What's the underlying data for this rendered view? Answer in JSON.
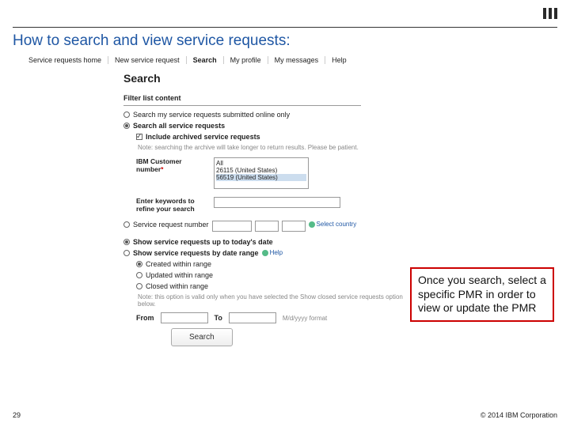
{
  "header": {
    "title": "How to search and view service requests:"
  },
  "nav": {
    "items": [
      "Service requests home",
      "New service request",
      "Search",
      "My profile",
      "My messages",
      "Help"
    ]
  },
  "search": {
    "heading": "Search",
    "filter_label": "Filter list content",
    "opt_online": "Search my service requests submitted online only",
    "opt_all": "Search all service requests",
    "include_archived": "Include archived service requests",
    "archived_note": "Note: searching the archive will take longer to return results. Please be patient.",
    "custnum_label": "IBM Customer number",
    "custnum_options": {
      "a": "All",
      "b": "26115    (United States)",
      "c": "56519    (United States)"
    },
    "keywords_label": "Enter keywords to refine your search",
    "srnum_label": "Service request number",
    "select_country": "Select country",
    "opt_today": "Show service requests up to today's date",
    "opt_range": "Show service requests by date range",
    "help_link": "Help",
    "created_label": "Created within range",
    "updated_label": "Updated within range",
    "closed_label": "Closed within range",
    "closed_note": "Note: this option is valid only when you have selected the Show closed service requests option below.",
    "from_label": "From",
    "to_label": "To",
    "date_format": "M/d/yyyy format",
    "button": "Search"
  },
  "callout": {
    "text": "Once you search, select a specific PMR in order to view or update the PMR"
  },
  "footer": {
    "page": "29",
    "copyright": "© 2014 IBM Corporation"
  }
}
